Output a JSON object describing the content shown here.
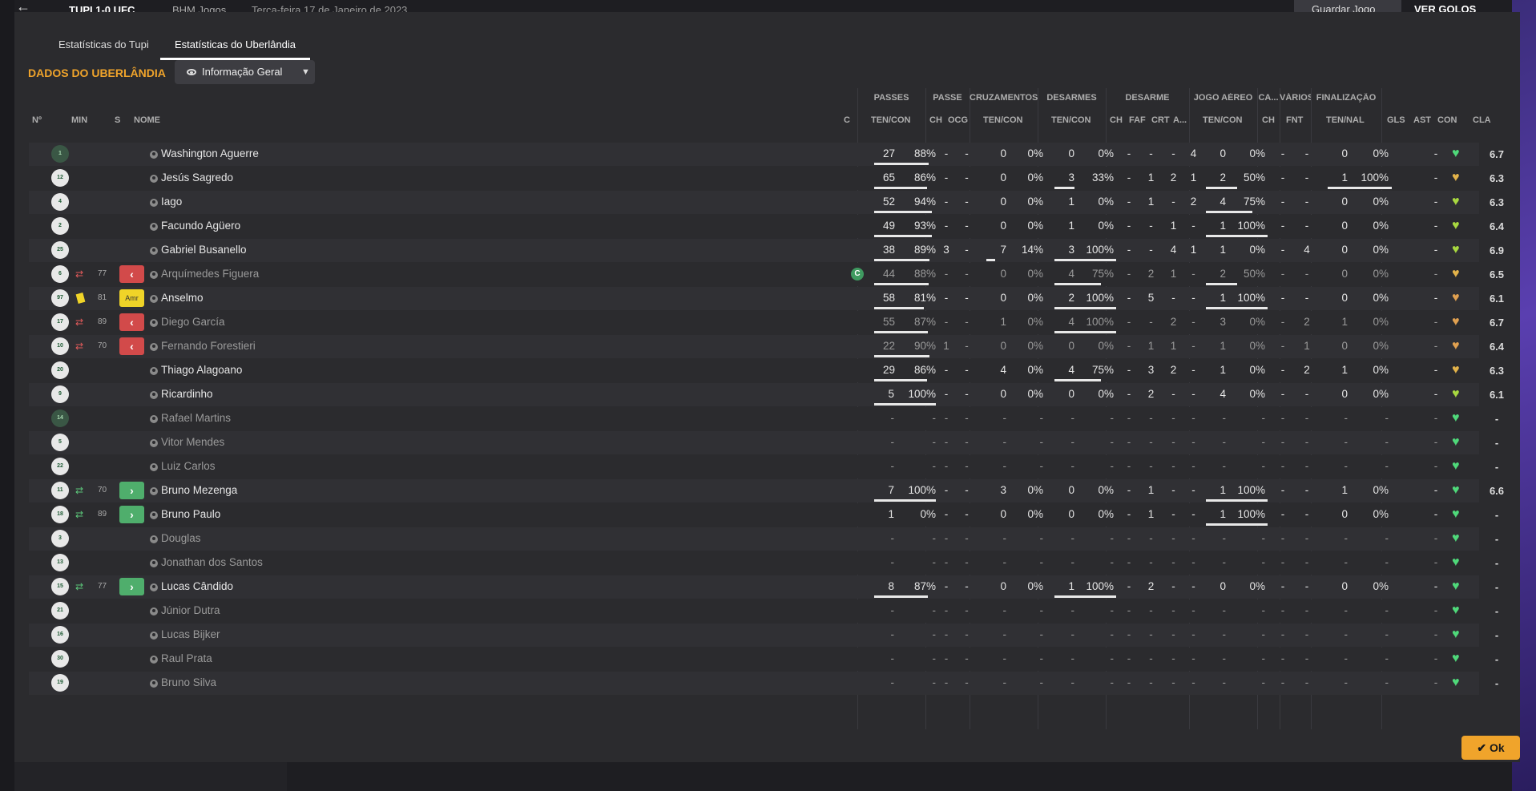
{
  "topbar": {
    "back_icon": "back-arrow-icon",
    "score": "TUPI 1-0 UFC",
    "competition": "BHM Jogos",
    "date": "Terça-feira 17 de Janeiro de 2023",
    "save_label": "Guardar Jogo",
    "goals_label": "VER GOLOS"
  },
  "tabs": [
    "Estatísticas do Tupi",
    "Estatísticas do Uberlândia"
  ],
  "active_tab": 1,
  "section_title": "DADOS DO UBERLÂNDIA",
  "view_dropdown": {
    "label": "Informação Geral",
    "icon": "eye-icon"
  },
  "group_headers": [
    "PASSES",
    "PASSE",
    "CRUZAMENTOS",
    "DESARMES",
    "DESARME",
    "JOGO AÉREO",
    "CA...",
    "VÁRIOS",
    "FINALIZAÇÃO"
  ],
  "column_headers": {
    "num": "Nº",
    "min": "MIN",
    "s": "S",
    "name": "NOME",
    "c": "C",
    "passes": "TEN/CON",
    "pch": "CH",
    "pocg": "OCG",
    "cross": "TEN/CON",
    "tack": "TEN/CON",
    "dch": "CH",
    "dfaf": "FAF",
    "dcrt": "CRT",
    "da": "A...",
    "air": "TEN/CON",
    "cach": "CH",
    "fnt": "FNT",
    "shots": "TEN/NAL",
    "gls": "GLS",
    "ast": "AST",
    "con": "CON",
    "cla": "CLA"
  },
  "colors": {
    "accent": "#f0a42b",
    "sub_off": "#d24a4a",
    "sub_on": "#4fae6c",
    "yellow_card": "#f0d428",
    "gk_shirt": "#3a5745"
  },
  "ok_label": "Ok",
  "rows": [
    {
      "num": "1",
      "gk": true,
      "name": "Washington Aguerre",
      "pas": "27",
      "pasp": "88%",
      "pch": "-",
      "pocg": "-",
      "cr": "0",
      "crp": "0%",
      "tk": "0",
      "tkp": "0%",
      "dch": "-",
      "faf": "-",
      "crt": "-",
      "da": "4",
      "ar": "0",
      "arp": "0%",
      "cach": "-",
      "fnt": "-",
      "sh": "0",
      "shp": "0%",
      "gls": "",
      "ast": "-",
      "con": "#4fd97a",
      "cla": "6.7",
      "pasf": 0.88,
      "crf": 0,
      "tkf": 0,
      "arf": 0,
      "shf": 0
    },
    {
      "num": "12",
      "name": "Jesús Sagredo",
      "pas": "65",
      "pasp": "86%",
      "pch": "-",
      "pocg": "-",
      "cr": "0",
      "crp": "0%",
      "tk": "3",
      "tkp": "33%",
      "dch": "-",
      "faf": "1",
      "crt": "2",
      "da": "1",
      "ar": "2",
      "arp": "50%",
      "cach": "-",
      "fnt": "-",
      "sh": "1",
      "shp": "100%",
      "gls": "",
      "ast": "-",
      "con": "#e3b34a",
      "cla": "6.3",
      "pasf": 0.86,
      "crf": 0,
      "tkf": 0.33,
      "arf": 0.5,
      "shf": 1
    },
    {
      "num": "4",
      "name": "Iago",
      "pas": "52",
      "pasp": "94%",
      "pch": "-",
      "pocg": "-",
      "cr": "0",
      "crp": "0%",
      "tk": "1",
      "tkp": "0%",
      "dch": "-",
      "faf": "1",
      "crt": "-",
      "da": "2",
      "ar": "4",
      "arp": "75%",
      "cach": "-",
      "fnt": "-",
      "sh": "0",
      "shp": "0%",
      "gls": "",
      "ast": "-",
      "con": "#a8d840",
      "cla": "6.3",
      "pasf": 0.94,
      "crf": 0,
      "tkf": 0,
      "arf": 0.75,
      "shf": 0
    },
    {
      "num": "2",
      "name": "Facundo Agüero",
      "pas": "49",
      "pasp": "93%",
      "pch": "-",
      "pocg": "-",
      "cr": "0",
      "crp": "0%",
      "tk": "1",
      "tkp": "0%",
      "dch": "-",
      "faf": "-",
      "crt": "1",
      "da": "-",
      "ar": "1",
      "arp": "100%",
      "cach": "-",
      "fnt": "-",
      "sh": "0",
      "shp": "0%",
      "gls": "",
      "ast": "-",
      "con": "#a8d840",
      "cla": "6.4",
      "pasf": 0.93,
      "crf": 0,
      "tkf": 0,
      "arf": 1,
      "shf": 0
    },
    {
      "num": "25",
      "name": "Gabriel Busanello",
      "pas": "38",
      "pasp": "89%",
      "pch": "3",
      "pocg": "-",
      "cr": "7",
      "crp": "14%",
      "tk": "3",
      "tkp": "100%",
      "dch": "-",
      "faf": "-",
      "crt": "4",
      "da": "1",
      "ar": "1",
      "arp": "0%",
      "cach": "-",
      "fnt": "4",
      "sh": "0",
      "shp": "0%",
      "gls": "",
      "ast": "-",
      "con": "#a8d840",
      "cla": "6.9",
      "pasf": 0.89,
      "crf": 0.14,
      "tkf": 1,
      "arf": 0,
      "shf": 0
    },
    {
      "num": "6",
      "name": "Arquímedes Figuera",
      "dimmed": true,
      "sub": "off",
      "min": "77",
      "captain": true,
      "pas": "44",
      "pasp": "88%",
      "pch": "-",
      "pocg": "-",
      "cr": "0",
      "crp": "0%",
      "tk": "4",
      "tkp": "75%",
      "dch": "-",
      "faf": "2",
      "crt": "1",
      "da": "-",
      "ar": "2",
      "arp": "50%",
      "cach": "-",
      "fnt": "-",
      "sh": "0",
      "shp": "0%",
      "gls": "",
      "ast": "-",
      "con": "#e3b34a",
      "cla": "6.5",
      "pasf": 0.88,
      "crf": 0,
      "tkf": 0.75,
      "arf": 0.5,
      "shf": 0
    },
    {
      "num": "97",
      "name": "Anselmo",
      "card": "yellow",
      "min": "81",
      "badge": "Amr",
      "pas": "58",
      "pasp": "81%",
      "pch": "-",
      "pocg": "-",
      "cr": "0",
      "crp": "0%",
      "tk": "2",
      "tkp": "100%",
      "dch": "-",
      "faf": "5",
      "crt": "-",
      "da": "-",
      "ar": "1",
      "arp": "100%",
      "cach": "-",
      "fnt": "-",
      "sh": "0",
      "shp": "0%",
      "gls": "",
      "ast": "-",
      "con": "#e0a050",
      "cla": "6.1",
      "pasf": 0.81,
      "crf": 0,
      "tkf": 1,
      "arf": 1,
      "shf": 0
    },
    {
      "num": "17",
      "name": "Diego García",
      "dimmed": true,
      "sub": "off",
      "min": "89",
      "pas": "55",
      "pasp": "87%",
      "pch": "-",
      "pocg": "-",
      "cr": "1",
      "crp": "0%",
      "tk": "4",
      "tkp": "100%",
      "dch": "-",
      "faf": "-",
      "crt": "2",
      "da": "-",
      "ar": "3",
      "arp": "0%",
      "cach": "-",
      "fnt": "2",
      "sh": "1",
      "shp": "0%",
      "gls": "",
      "ast": "-",
      "con": "#e0a050",
      "cla": "6.7",
      "pasf": 0.87,
      "crf": 0,
      "tkf": 1,
      "arf": 0,
      "shf": 0
    },
    {
      "num": "10",
      "name": "Fernando Forestieri",
      "dimmed": true,
      "sub": "off",
      "min": "70",
      "pas": "22",
      "pasp": "90%",
      "pch": "1",
      "pocg": "-",
      "cr": "0",
      "crp": "0%",
      "tk": "0",
      "tkp": "0%",
      "dch": "-",
      "faf": "1",
      "crt": "1",
      "da": "-",
      "ar": "1",
      "arp": "0%",
      "cach": "-",
      "fnt": "1",
      "sh": "0",
      "shp": "0%",
      "gls": "",
      "ast": "-",
      "con": "#e0a050",
      "cla": "6.4",
      "pasf": 0.9,
      "crf": 0,
      "tkf": 0,
      "arf": 0,
      "shf": 0
    },
    {
      "num": "20",
      "name": "Thiago Alagoano",
      "pas": "29",
      "pasp": "86%",
      "pch": "-",
      "pocg": "-",
      "cr": "4",
      "crp": "0%",
      "tk": "4",
      "tkp": "75%",
      "dch": "-",
      "faf": "3",
      "crt": "2",
      "da": "-",
      "ar": "1",
      "arp": "0%",
      "cach": "-",
      "fnt": "2",
      "sh": "1",
      "shp": "0%",
      "gls": "",
      "ast": "-",
      "con": "#e3b34a",
      "cla": "6.3",
      "pasf": 0.86,
      "crf": 0,
      "tkf": 0.75,
      "arf": 0,
      "shf": 0
    },
    {
      "num": "9",
      "name": "Ricardinho",
      "pas": "5",
      "pasp": "100%",
      "pch": "-",
      "pocg": "-",
      "cr": "0",
      "crp": "0%",
      "tk": "0",
      "tkp": "0%",
      "dch": "-",
      "faf": "2",
      "crt": "-",
      "da": "-",
      "ar": "4",
      "arp": "0%",
      "cach": "-",
      "fnt": "-",
      "sh": "0",
      "shp": "0%",
      "gls": "",
      "ast": "-",
      "con": "#a8d840",
      "cla": "6.1",
      "pasf": 1,
      "crf": 0,
      "tkf": 0,
      "arf": 0,
      "shf": 0
    },
    {
      "num": "14",
      "gk": true,
      "dimmed": true,
      "name": "Rafael Martins",
      "empty": true,
      "gls": "",
      "ast": "-",
      "con": "#4fd97a",
      "cla": "-"
    },
    {
      "num": "5",
      "dimmed": true,
      "name": "Vitor Mendes",
      "empty": true,
      "gls": "",
      "ast": "-",
      "con": "#4fd97a",
      "cla": "-"
    },
    {
      "num": "22",
      "dimmed": true,
      "name": "Luiz Carlos",
      "empty": true,
      "gls": "",
      "ast": "-",
      "con": "#4fd97a",
      "cla": "-"
    },
    {
      "num": "11",
      "name": "Bruno Mezenga",
      "sub": "on",
      "min": "70",
      "pas": "7",
      "pasp": "100%",
      "pch": "-",
      "pocg": "-",
      "cr": "3",
      "crp": "0%",
      "tk": "0",
      "tkp": "0%",
      "dch": "-",
      "faf": "1",
      "crt": "-",
      "da": "-",
      "ar": "1",
      "arp": "100%",
      "cach": "-",
      "fnt": "-",
      "sh": "1",
      "shp": "0%",
      "gls": "",
      "ast": "-",
      "con": "#4fd97a",
      "cla": "6.6",
      "pasf": 1,
      "crf": 0,
      "tkf": 0,
      "arf": 1,
      "shf": 0
    },
    {
      "num": "18",
      "name": "Bruno Paulo",
      "sub": "on",
      "min": "89",
      "pas": "1",
      "pasp": "0%",
      "pch": "-",
      "pocg": "-",
      "cr": "0",
      "crp": "0%",
      "tk": "0",
      "tkp": "0%",
      "dch": "-",
      "faf": "1",
      "crt": "-",
      "da": "-",
      "ar": "1",
      "arp": "100%",
      "cach": "-",
      "fnt": "-",
      "sh": "0",
      "shp": "0%",
      "gls": "",
      "ast": "-",
      "con": "#4fd97a",
      "cla": "-",
      "pasf": 0,
      "crf": 0,
      "tkf": 0,
      "arf": 1,
      "shf": 0
    },
    {
      "num": "3",
      "dimmed": true,
      "name": "Douglas",
      "empty": true,
      "gls": "",
      "ast": "-",
      "con": "#4fd97a",
      "cla": "-"
    },
    {
      "num": "13",
      "dimmed": true,
      "name": "Jonathan dos Santos",
      "empty": true,
      "gls": "",
      "ast": "-",
      "con": "#4fd97a",
      "cla": "-"
    },
    {
      "num": "15",
      "name": "Lucas Cândido",
      "sub": "on",
      "min": "77",
      "pas": "8",
      "pasp": "87%",
      "pch": "-",
      "pocg": "-",
      "cr": "0",
      "crp": "0%",
      "tk": "1",
      "tkp": "100%",
      "dch": "-",
      "faf": "2",
      "crt": "-",
      "da": "-",
      "ar": "0",
      "arp": "0%",
      "cach": "-",
      "fnt": "-",
      "sh": "0",
      "shp": "0%",
      "gls": "",
      "ast": "-",
      "con": "#4fd97a",
      "cla": "-",
      "pasf": 0.87,
      "crf": 0,
      "tkf": 1,
      "arf": 0,
      "shf": 0
    },
    {
      "num": "21",
      "dimmed": true,
      "name": "Júnior Dutra",
      "empty": true,
      "gls": "",
      "ast": "-",
      "con": "#4fd97a",
      "cla": "-"
    },
    {
      "num": "16",
      "dimmed": true,
      "name": "Lucas Bijker",
      "empty": true,
      "gls": "",
      "ast": "-",
      "con": "#4fd97a",
      "cla": "-"
    },
    {
      "num": "30",
      "dimmed": true,
      "name": "Raul Prata",
      "empty": true,
      "gls": "",
      "ast": "-",
      "con": "#4fd97a",
      "cla": "-"
    },
    {
      "num": "19",
      "dimmed": true,
      "name": "Bruno Silva",
      "empty": true,
      "gls": "",
      "ast": "-",
      "con": "#4fd97a",
      "cla": "-"
    }
  ]
}
